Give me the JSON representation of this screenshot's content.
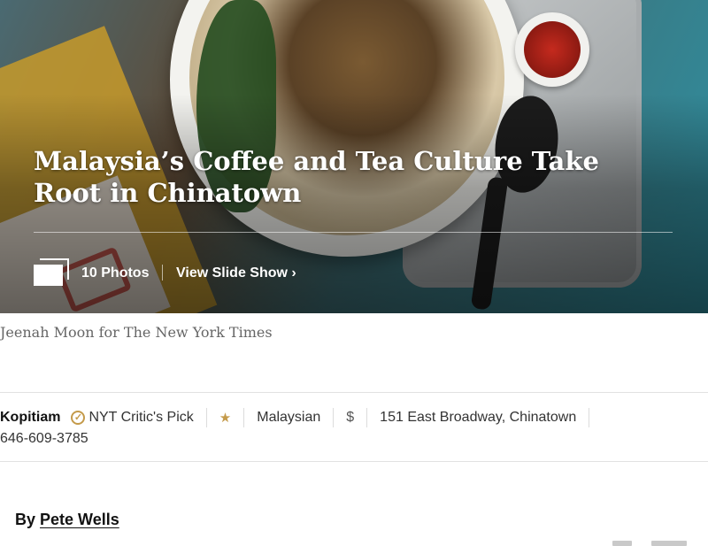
{
  "hero": {
    "headline": "Malaysia’s Coffee and Tea Culture Take Root in Chinatown",
    "photo_count": "10 Photos",
    "slideshow_label": "View Slide Show ›"
  },
  "caption": "Jeenah Moon for The New York Times",
  "restaurant": {
    "name": "Kopitiam",
    "critic_pick": "NYT Critic's Pick",
    "stars": "★",
    "cuisine": "Malaysian",
    "price": "$",
    "address": "151 East Broadway, Chinatown",
    "phone": "646-609-3785"
  },
  "byline": {
    "prefix": "By",
    "author": "Pete Wells"
  },
  "colors": {
    "critic_gold": "#c49a4a",
    "caption_gray": "#666666"
  }
}
